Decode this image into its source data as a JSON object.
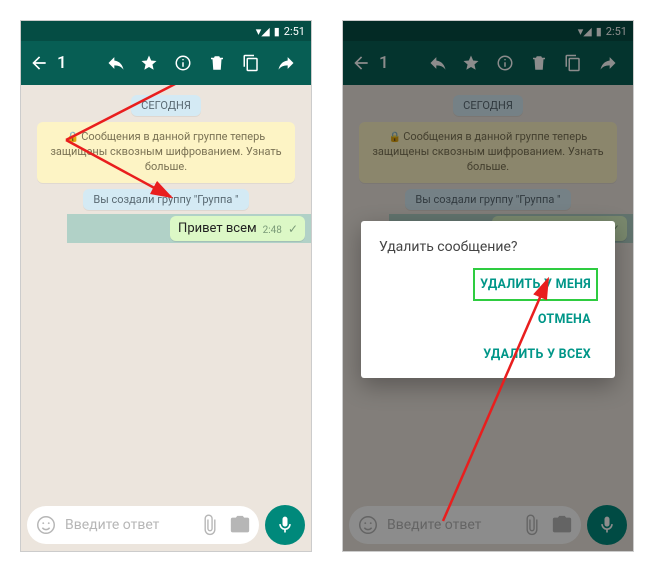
{
  "statusbar": {
    "time": "2:51"
  },
  "appbar": {
    "count": "1"
  },
  "chat": {
    "date": "СЕГОДНЯ",
    "encryption": "Сообщения в данной группе теперь защищены сквозным шифрованием. Узнать больше.",
    "system": "Вы создали группу \"Группа \"",
    "message": {
      "text": "Привет всем",
      "time": "2:48"
    }
  },
  "input": {
    "placeholder": "Введите ответ"
  },
  "dialog": {
    "title": "Удалить сообщение?",
    "delete_me": "УДАЛИТЬ У МЕНЯ",
    "cancel": "ОТМЕНА",
    "delete_all": "УДАЛИТЬ У ВСЕХ"
  }
}
